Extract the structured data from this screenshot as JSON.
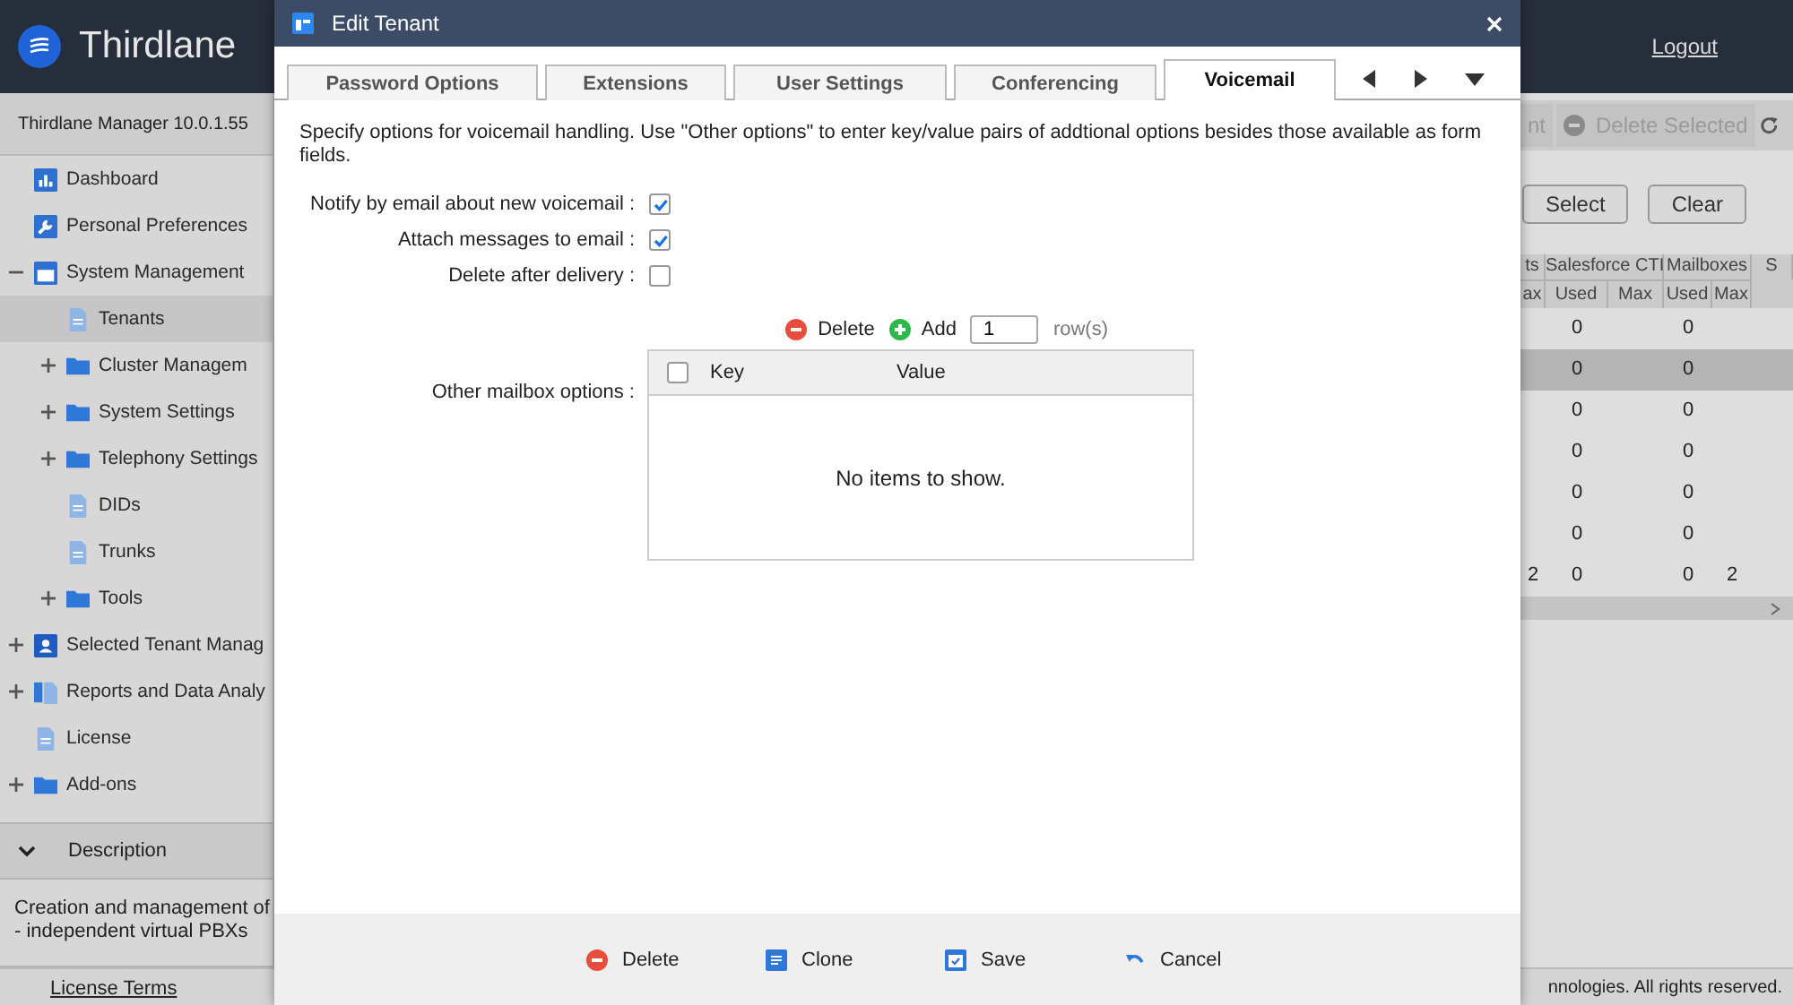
{
  "header": {
    "brand": "Thirdlane",
    "links": [
      {
        "label": "Logout"
      }
    ]
  },
  "sidebar": {
    "version": "Thirdlane Manager 10.0.1.55",
    "tree": [
      {
        "label": "Dashboard",
        "kind": "chart",
        "selected": false
      },
      {
        "label": "Personal Preferences",
        "kind": "wrench",
        "selected": false
      },
      {
        "label": "System Management",
        "kind": "window",
        "selected": false,
        "expanded": true,
        "children": [
          {
            "label": "Tenants",
            "kind": "doc",
            "selected": true
          },
          {
            "label": "Cluster Managem",
            "kind": "folder",
            "selected": false,
            "expanded": false
          },
          {
            "label": "System Settings",
            "kind": "folder",
            "selected": false,
            "expanded": false
          },
          {
            "label": "Telephony Settings",
            "kind": "folder",
            "selected": false,
            "expanded": false
          },
          {
            "label": "DIDs",
            "kind": "doc",
            "selected": false
          },
          {
            "label": "Trunks",
            "kind": "doc",
            "selected": false
          },
          {
            "label": "Tools",
            "kind": "folder",
            "selected": false,
            "expanded": false
          }
        ]
      },
      {
        "label": "Selected Tenant Manag",
        "kind": "contact",
        "selected": false,
        "expanded": false
      },
      {
        "label": "Reports and Data Analy",
        "kind": "docs",
        "selected": false,
        "expanded": false
      },
      {
        "label": "License",
        "kind": "doc",
        "selected": false
      },
      {
        "label": "Add-ons",
        "kind": "folder",
        "selected": false,
        "expanded": false
      }
    ],
    "description_title": "Description",
    "description": "Creation and management of\n- independent virtual PBXs",
    "license_link": "License Terms"
  },
  "toolbar": {
    "buttons": [
      {
        "label": "nt",
        "kind": "plain"
      },
      {
        "label": "Delete Selected",
        "kind": "delete"
      }
    ]
  },
  "filter_buttons": [
    "Select",
    "Clear"
  ],
  "table": {
    "groups": [
      "ts",
      "Salesforce CTI",
      "Mailboxes",
      "S"
    ],
    "subheaders": [
      "ax",
      "Used",
      "Max",
      "Used",
      "Max"
    ],
    "rows": [
      {
        "selected": false,
        "cells": [
          "",
          "0",
          "",
          "0",
          ""
        ]
      },
      {
        "selected": true,
        "cells": [
          "",
          "0",
          "",
          "0",
          ""
        ]
      },
      {
        "selected": false,
        "cells": [
          "",
          "0",
          "",
          "0",
          ""
        ]
      },
      {
        "selected": false,
        "cells": [
          "",
          "0",
          "",
          "0",
          ""
        ]
      },
      {
        "selected": false,
        "cells": [
          "",
          "0",
          "",
          "0",
          ""
        ]
      },
      {
        "selected": false,
        "cells": [
          "",
          "0",
          "",
          "0",
          ""
        ]
      },
      {
        "selected": false,
        "cells": [
          "2",
          "0",
          "",
          "0",
          "2"
        ]
      }
    ]
  },
  "footer": "nnologies. All rights reserved.",
  "dialog": {
    "title": "Edit Tenant",
    "tabs": [
      {
        "label": "Password Options",
        "selected": false
      },
      {
        "label": "Extensions",
        "selected": false
      },
      {
        "label": "User Settings",
        "selected": false
      },
      {
        "label": "Conferencing",
        "selected": false
      },
      {
        "label": "Voicemail",
        "selected": true
      }
    ],
    "intro": "Specify options for voicemail handling. Use \"Other options\" to enter key/value pairs of addtional options besides those available as form fields.",
    "options": [
      {
        "label": "Notify by email about new voicemail :",
        "checked": true
      },
      {
        "label": "Attach messages to email :",
        "checked": true
      },
      {
        "label": "Delete after delivery :",
        "checked": false
      }
    ],
    "other": {
      "label": "Other mailbox options :",
      "actions": [
        {
          "label": "Delete",
          "kind": "delete"
        },
        {
          "label": "Add",
          "kind": "add"
        }
      ],
      "rows_value": "1",
      "rows_unit": "row(s)",
      "columns": [
        "Key",
        "Value"
      ],
      "select_all": false,
      "empty": "No items to show."
    },
    "buttons": [
      {
        "label": "Delete",
        "kind": "delete"
      },
      {
        "label": "Clone",
        "kind": "clone"
      },
      {
        "label": "Save",
        "kind": "save"
      },
      {
        "label": "Cancel",
        "kind": "cancel"
      }
    ]
  }
}
